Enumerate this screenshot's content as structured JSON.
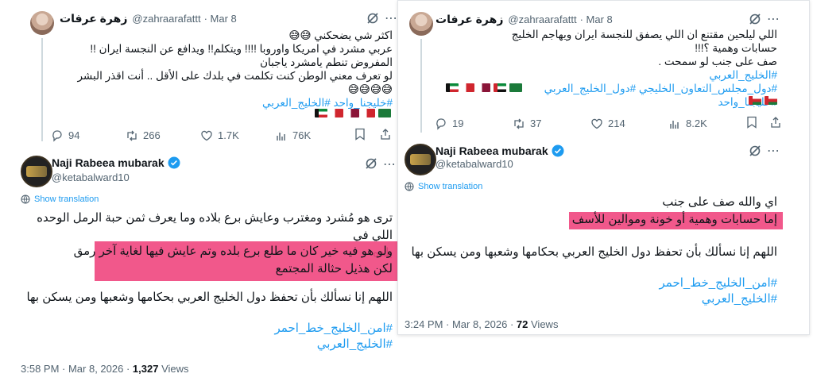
{
  "left": {
    "tweet1": {
      "name": "زهرة عرفات",
      "handle": "@zahraarafattt",
      "date": "· Mar 8",
      "lines": [
        "اكثر شي يضحكني 😅😅",
        "عربي مشرد في امريكا واوروبا !!!! ويتكلم!! ويدافع عن النجسة ايران !!",
        "المفروض تنطم يامشرد ياجبان",
        "لو تعرف معني الوطن كنت تكلمت في بلدك على الأقل .. أنت اقذر البشر",
        "😅😅😅😅"
      ],
      "hashtags": "#خليجنا_واحد #الخليج_العربي",
      "replies": "94",
      "retweets": "266",
      "likes": "1.7K",
      "views": "76K"
    },
    "tweet2": {
      "name": "Naji Rabeea mubarak",
      "handle": "@ketabalward10",
      "show_translation": "Show translation",
      "para1_line1": "ترى هو مُشرد ومغترب وعايش برع بلاده وما يعرف ثمن حبة الرمل الوحده اللي في",
      "para1_line2": "بلده",
      "hl_line1": "ولو هو فيه خير كان ما طلع برع بلده وتم عايش فيها لغاية آخر رمق",
      "hl_line2": "لكن هذيل حثالة المجتمع",
      "prayer": "اللهم إنا نسألك بأن تحفظ دول الخليج العربي بحكامها وشعبها ومن يسكن بها",
      "tag1": "#امن_الخليج_خط_احمر",
      "tag2": "#الخليج_العربي",
      "time": "3:58 PM · Mar 8, 2026 ·",
      "views": "1,327",
      "views_label": "Views"
    }
  },
  "right": {
    "tweet1": {
      "name": "زهرة عرفات",
      "handle": "@zahraarafattt",
      "date": "· Mar 8",
      "lines": [
        "اللي ليلحين مقتنع ان اللي يصفق للنجسة ايران ويهاجم الخليج",
        "حسابات وهمية ؟!!!",
        "صف على جنب لو سمحت ."
      ],
      "tag1": "#الخليج_العربي",
      "tag2": "#دول_مجلس_التعاون_الخليجي #دول_الخليج_العربي #خليجنا_واحد",
      "replies": "19",
      "retweets": "37",
      "likes": "214",
      "views": "8.2K"
    },
    "tweet2": {
      "name": "Naji Rabeea mubarak",
      "handle": "@ketabalward10",
      "show_translation": "Show translation",
      "line1": "اي والله صف على جنب",
      "hl_line": "إما حسابات وهمية أو خونة وموالين للأسف",
      "prayer": "اللهم إنا نسألك بأن تحفظ دول الخليج العربي بحكامها وشعبها ومن يسكن بها",
      "tag1": "#امن_الخليج_خط_احمر",
      "tag2": "#الخليج_العربي",
      "time": "3:24 PM · Mar 8, 2026 ·",
      "views": "72",
      "views_label": "Views"
    }
  },
  "colors": {
    "accent": "#1d9bf0",
    "highlight": "#f0467e",
    "text": "#0f1419",
    "muted": "#536471"
  }
}
